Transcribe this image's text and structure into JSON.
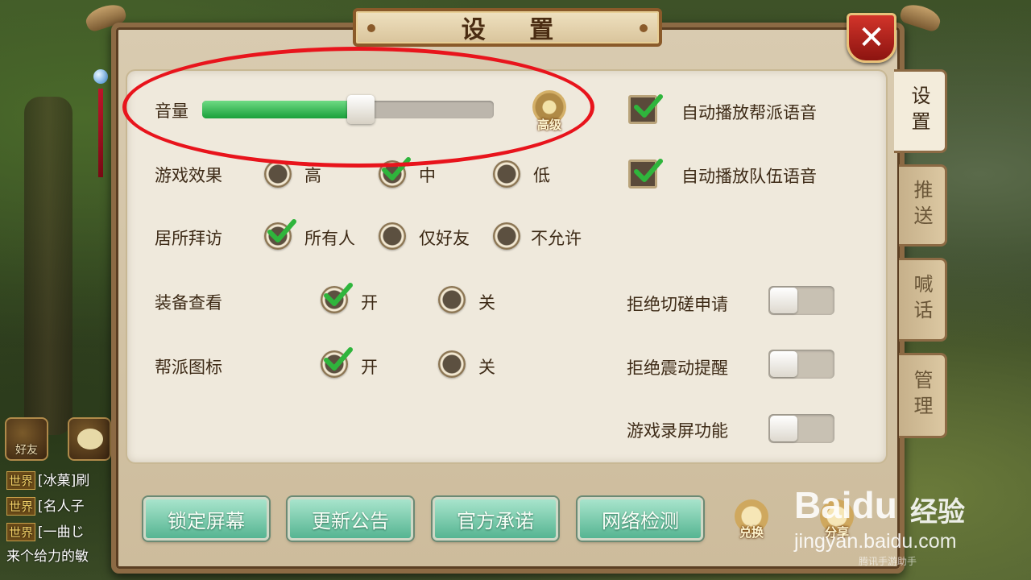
{
  "dialog": {
    "title": "设 置",
    "close_label": "✕"
  },
  "side_tabs": [
    {
      "label": "设置",
      "active": true
    },
    {
      "label": "推送",
      "active": false
    },
    {
      "label": "喊话",
      "active": false
    },
    {
      "label": "管理",
      "active": false
    }
  ],
  "volume": {
    "label": "音量",
    "level_percent": 55,
    "advanced_label": "高级"
  },
  "graphics": {
    "label": "游戏效果",
    "options": [
      "高",
      "中",
      "低"
    ],
    "selected": "中"
  },
  "home_visit": {
    "label": "居所拜访",
    "options": [
      "所有人",
      "仅好友",
      "不允许"
    ],
    "selected": "所有人"
  },
  "equip_view": {
    "label": "装备查看",
    "options": [
      "开",
      "关"
    ],
    "selected": "开"
  },
  "guild_icon": {
    "label": "帮派图标",
    "options": [
      "开",
      "关"
    ],
    "selected": "开"
  },
  "auto_voice": {
    "guild": {
      "label": "自动播放帮派语音",
      "checked": true
    },
    "team": {
      "label": "自动播放队伍语音",
      "checked": true
    }
  },
  "toggles": {
    "refuse_duel": {
      "label": "拒绝切磋申请",
      "on": false
    },
    "refuse_vibrate": {
      "label": "拒绝震动提醒",
      "on": false
    },
    "screen_record": {
      "label": "游戏录屏功能",
      "on": false
    }
  },
  "bottom_buttons": [
    "锁定屏幕",
    "更新公告",
    "官方承诺",
    "网络检测"
  ],
  "extra_buttons": {
    "redeem": "兑换",
    "share": "分享"
  },
  "chat": {
    "friends_label": "好友",
    "lines": [
      {
        "channel": "世界",
        "text": "[冰菓]刷"
      },
      {
        "channel": "世界",
        "text": "[名人子"
      },
      {
        "channel": "世界",
        "text": "[一曲じ"
      },
      {
        "channel": "",
        "text": "来个给力的敏"
      }
    ]
  },
  "watermark": {
    "brand": "Bai",
    "brand_suffix": "du",
    "brand_cn": "经验",
    "url": "jingyan.baidu.com",
    "source": "腾讯手游助手"
  },
  "colors": {
    "check_green": "#2fb53c",
    "slider_green": "#19a03a",
    "annotation_red": "#e8141c",
    "button_teal": "#56b592"
  }
}
